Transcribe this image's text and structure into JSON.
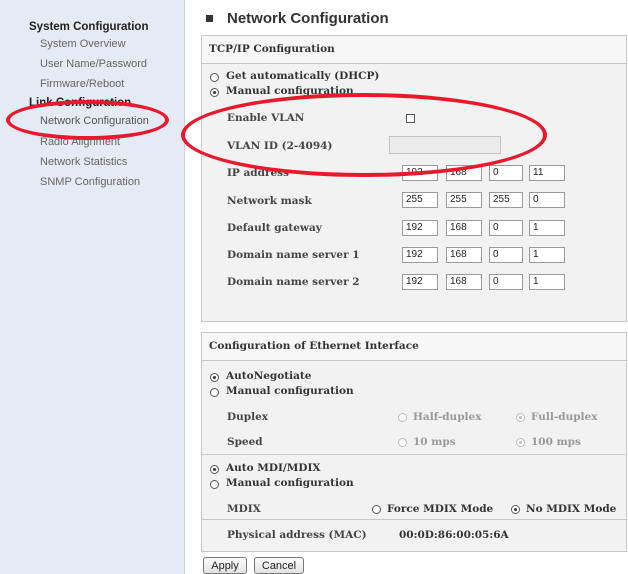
{
  "sidebar": {
    "system_section": "System Configuration",
    "system_items": [
      "System Overview",
      "User Name/Password",
      "Firmware/Reboot"
    ],
    "link_section": "Link Configuration",
    "link_items": [
      "Network Configuration",
      "Radio Alignment",
      "Network Statistics",
      "SNMP Configuration"
    ],
    "selected": "Network Configuration"
  },
  "page_title": "Network Configuration",
  "tcpip": {
    "title": "TCP/IP Configuration",
    "mode_options": [
      "Get automatically (DHCP)",
      "Manual configuration"
    ],
    "mode_selected": "Manual configuration",
    "enable_vlan_label": "Enable VLAN",
    "enable_vlan_checked": false,
    "vlan_id_label": "VLAN ID (2-4094)",
    "vlan_id_value": "",
    "rows": [
      {
        "label": "IP address",
        "octets": [
          "192",
          "168",
          "0",
          "11"
        ]
      },
      {
        "label": "Network mask",
        "octets": [
          "255",
          "255",
          "255",
          "0"
        ]
      },
      {
        "label": "Default gateway",
        "octets": [
          "192",
          "168",
          "0",
          "1"
        ]
      },
      {
        "label": "Domain name server 1",
        "octets": [
          "192",
          "168",
          "0",
          "1"
        ]
      },
      {
        "label": "Domain name server 2",
        "octets": [
          "192",
          "168",
          "0",
          "1"
        ]
      }
    ]
  },
  "ethernet": {
    "title": "Configuration of Ethernet Interface",
    "neg_options": [
      "AutoNegotiate",
      "Manual configuration"
    ],
    "neg_selected": "AutoNegotiate",
    "duplex_label": "Duplex",
    "duplex_options": [
      "Half-duplex",
      "Full-duplex"
    ],
    "duplex_selected": "Full-duplex",
    "speed_label": "Speed",
    "speed_options": [
      "10 mps",
      "100 mps"
    ],
    "speed_selected": "100 mps",
    "mdi_options": [
      "Auto MDI/MDIX",
      "Manual configuration"
    ],
    "mdi_selected": "Auto MDI/MDIX",
    "mdix_label": "MDIX",
    "mdix_options": [
      "Force MDIX Mode",
      "No MDIX Mode"
    ],
    "mdix_selected": "No MDIX Mode",
    "mac_label": "Physical address (MAC)",
    "mac_value": "00:0D:86:00:05:6A"
  },
  "buttons": {
    "apply": "Apply",
    "cancel": "Cancel"
  },
  "colors": {
    "annotation": "#e8192c",
    "sidebar_bg": "#e4ebf4",
    "panel_bg": "#f2f2f2"
  }
}
